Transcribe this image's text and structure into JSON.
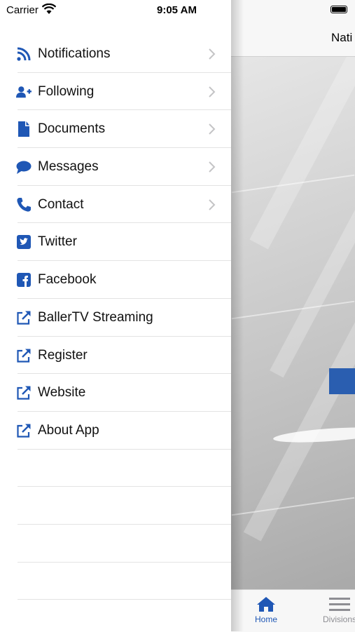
{
  "status_bar": {
    "carrier": "Carrier",
    "time": "9:05 AM"
  },
  "app": {
    "title": "Nati",
    "tabs": [
      {
        "label": "Home",
        "icon": "home-icon",
        "selected": true
      },
      {
        "label": "Divisions",
        "icon": "menu-icon",
        "selected": false
      }
    ]
  },
  "menu": {
    "items": [
      {
        "label": "Notifications",
        "icon": "rss-icon",
        "chevron": true
      },
      {
        "label": "Following",
        "icon": "user-plus-icon",
        "chevron": true
      },
      {
        "label": "Documents",
        "icon": "document-icon",
        "chevron": true
      },
      {
        "label": "Messages",
        "icon": "chat-bubble-icon",
        "chevron": true
      },
      {
        "label": "Contact",
        "icon": "phone-icon",
        "chevron": true
      },
      {
        "label": "Twitter",
        "icon": "twitter-square-icon",
        "chevron": false
      },
      {
        "label": "Facebook",
        "icon": "facebook-square-icon",
        "chevron": false
      },
      {
        "label": "BallerTV Streaming",
        "icon": "external-link-icon",
        "chevron": false
      },
      {
        "label": "Register",
        "icon": "external-link-icon",
        "chevron": false
      },
      {
        "label": "Website",
        "icon": "external-link-icon",
        "chevron": false
      },
      {
        "label": "About App",
        "icon": "external-link-icon",
        "chevron": false
      }
    ]
  },
  "colors": {
    "accent": "#1f57b5",
    "separator": "#e3e3e3",
    "chevron": "#c4c4c6"
  }
}
